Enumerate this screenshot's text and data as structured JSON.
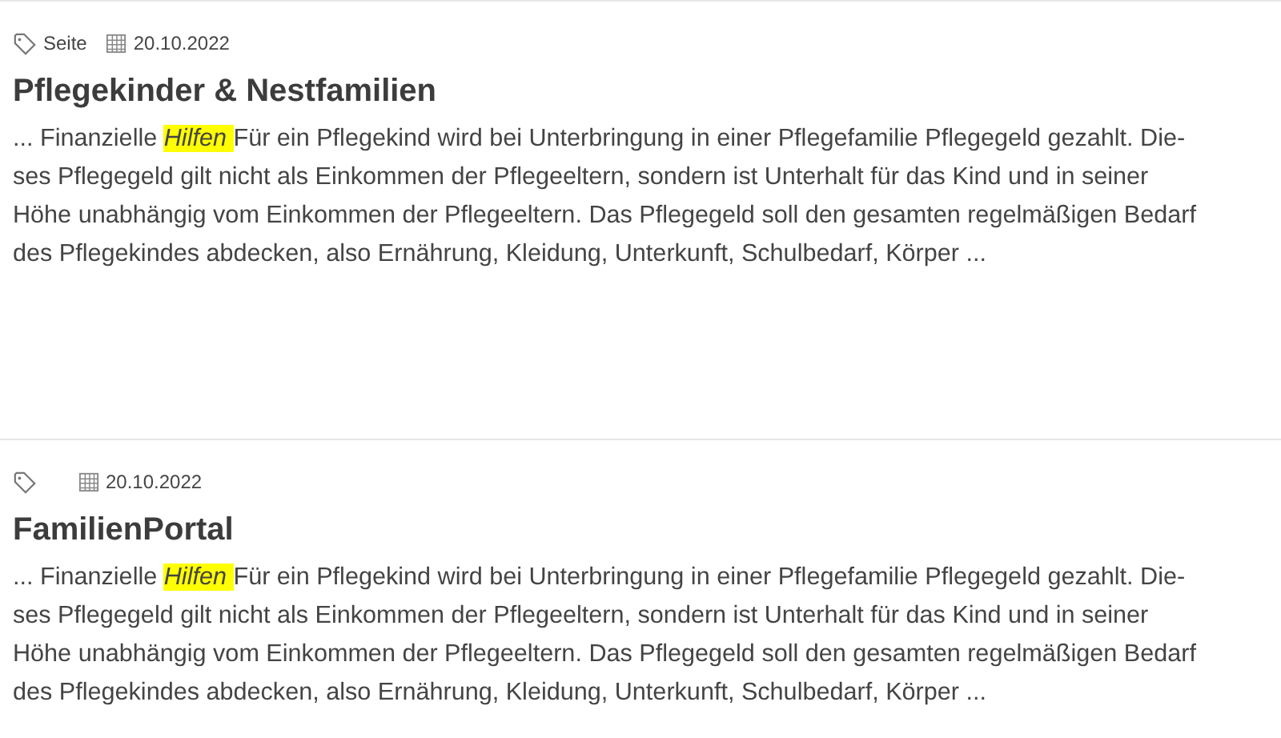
{
  "results": [
    {
      "type": "Seite",
      "date": "20.10.2022",
      "title": "Pflegekinder & Nestfamilien",
      "snippet": [
        {
          "text": "... Finanzielle ",
          "highlight": false
        },
        {
          "text": "Hilfen ",
          "highlight": true
        },
        {
          "text": " Für ein Pflegekind wird bei Unterbringung in einer Pflegefamilie Pflegegeld gezahlt. Die-\nses Pflegegeld gilt nicht als Einkommen der Pflegeeltern, sondern ist Unterhalt für das Kind und in seiner\nHöhe unabhängig vom Einkommen der Pflegeeltern. Das Pflegegeld soll den gesamten regelmäßigen Bedarf\ndes Pflegekindes abdecken, also Ernährung, Kleidung, Unterkunft, Schulbedarf, Körper ...",
          "highlight": false
        }
      ]
    },
    {
      "date": "20.10.2022",
      "title": "FamilienPortal",
      "snippet": [
        {
          "text": "... Finanzielle ",
          "highlight": false
        },
        {
          "text": "Hilfen ",
          "highlight": true
        },
        {
          "text": " Für ein Pflegekind wird bei Unterbringung in einer Pflegefamilie Pflegegeld gezahlt. Die-\nses Pflegegeld gilt nicht als Einkommen der Pflegeeltern, sondern ist Unterhalt für das Kind und in seiner\nHöhe unabhängig vom Einkommen der Pflegeeltern. Das Pflegegeld soll den gesamten regelmäßigen Bedarf\ndes Pflegekindes abdecken, also Ernährung, Kleidung, Unterkunft, Schulbedarf, Körper ...",
          "highlight": false
        }
      ]
    }
  ]
}
